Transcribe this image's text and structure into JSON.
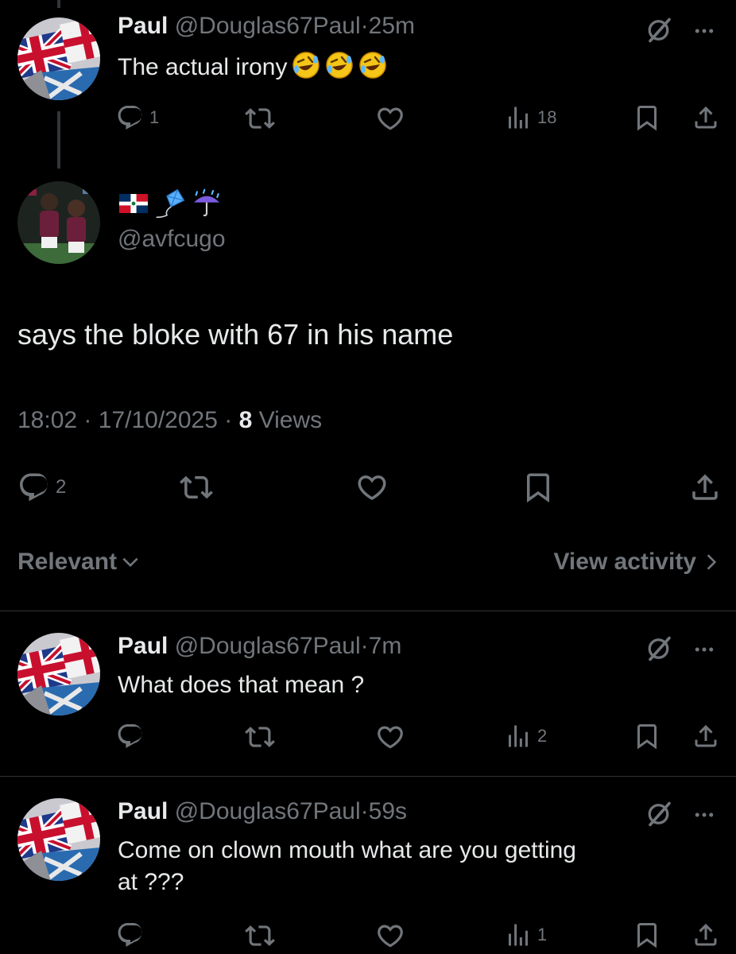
{
  "colors": {
    "background": "#000000",
    "text": "#e7e9ea",
    "muted": "#71767b",
    "divider": "#2f3336"
  },
  "reply1": {
    "name": "Paul",
    "handle": "@Douglas67Paul",
    "separator": "·",
    "time": "25m",
    "text": "The actual irony",
    "emojis": [
      "rofl-emoji",
      "rofl-emoji",
      "rofl-emoji"
    ],
    "reply_count": "1",
    "views_count": "18"
  },
  "main_post": {
    "display_name_emojis": [
      "dominican-flag-emoji",
      "kite-emoji",
      "umbrella-rain-emoji"
    ],
    "handle": "@avfcugo",
    "text": "says the bloke with 67 in his name",
    "time": "18:02",
    "date": "17/10/2025",
    "separator": "·",
    "views_number": "8",
    "views_label": "Views",
    "reply_count": "2"
  },
  "filter_bar": {
    "sort_label": "Relevant",
    "view_activity_label": "View activity"
  },
  "reply2": {
    "name": "Paul",
    "handle": "@Douglas67Paul",
    "separator": "·",
    "time": "7m",
    "text": "What does that mean ?",
    "views_count": "2"
  },
  "reply3": {
    "name": "Paul",
    "handle": "@Douglas67Paul",
    "separator": "·",
    "time": "59s",
    "text_line1": "Come on clown mouth what are you getting",
    "text_line2": "at ???",
    "views_count": "1"
  }
}
